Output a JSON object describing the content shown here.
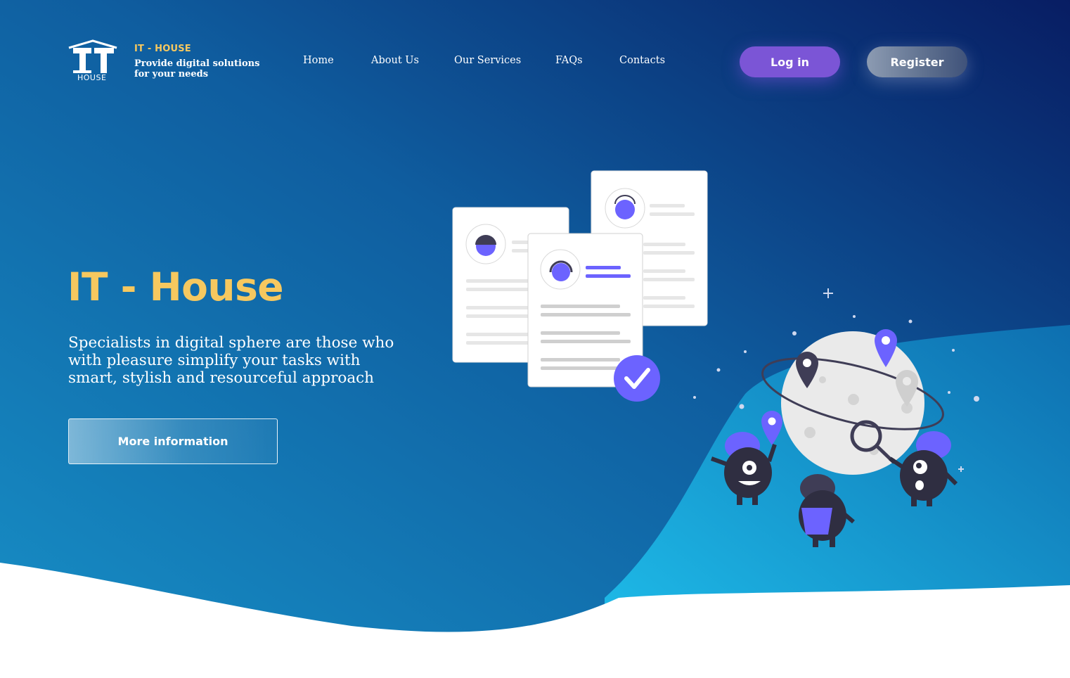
{
  "brand": {
    "logo_text": "IT",
    "logo_subtext": "HOUSE",
    "name": "IT - HOUSE",
    "tagline": "Provide digital solutions for your needs"
  },
  "nav": {
    "items": [
      {
        "label": "Home"
      },
      {
        "label": "About Us"
      },
      {
        "label": "Our Services"
      },
      {
        "label": "FAQs"
      },
      {
        "label": "Contacts"
      }
    ]
  },
  "auth": {
    "login_label": "Log in",
    "register_label": "Register"
  },
  "hero": {
    "title": "IT - House",
    "description": "Specialists in digital sphere are those who with pleasure simplify your tasks with smart, stylish and resourceful approach",
    "cta_label": "More information"
  },
  "colors": {
    "accent_yellow": "#f6c85f",
    "accent_purple": "#7b55d6",
    "illustration_purple": "#6c63ff",
    "bg_dark": "#0a2a6e",
    "bg_light": "#1890c8"
  }
}
